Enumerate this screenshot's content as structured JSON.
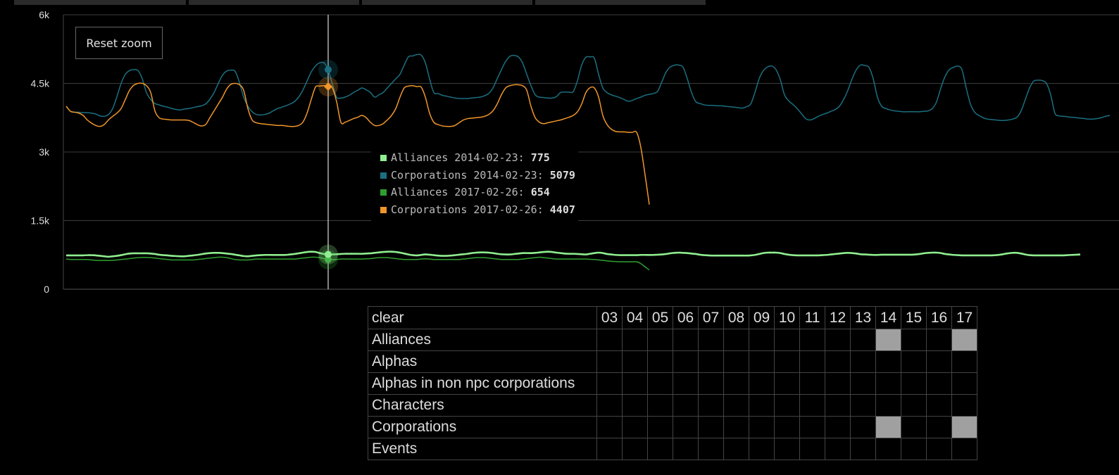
{
  "colors": {
    "alliances_2014": "#90ee90",
    "corporations_2014": "#1b6f80",
    "alliances_2017": "#2fa02f",
    "corporations_2017": "#f0962a",
    "crosshair": "#cccccc",
    "selected_cell": "#a0a0a0"
  },
  "controls": {
    "reset_zoom_label": "Reset zoom"
  },
  "tooltip": {
    "rows": [
      {
        "label": "Alliances 2014-02-23: ",
        "value": "775",
        "color": "#90ee90"
      },
      {
        "label": "Corporations 2014-02-23: ",
        "value": "5079",
        "color": "#1b6f80"
      },
      {
        "label": "Alliances 2017-02-26: ",
        "value": "654",
        "color": "#2fa02f"
      },
      {
        "label": "Corporations 2017-02-26: ",
        "value": "4407",
        "color": "#f0962a"
      }
    ]
  },
  "chart_data": {
    "type": "line",
    "ylim": [
      0,
      6000
    ],
    "y_ticks": [
      {
        "value": 0,
        "label": "0"
      },
      {
        "value": 1500,
        "label": "1.5k"
      },
      {
        "value": 3000,
        "label": "3k"
      },
      {
        "value": 4500,
        "label": "4.5k"
      },
      {
        "value": 6000,
        "label": "6k"
      }
    ],
    "grid": true,
    "hover_index": 62,
    "series": [
      {
        "name": "Corporations 2014-02-23",
        "color": "#1b6f80",
        "values": [
          4000,
          3890,
          3870,
          3870,
          3860,
          3860,
          3850,
          3830,
          3790,
          3780,
          3820,
          3950,
          4210,
          4500,
          4700,
          4780,
          4800,
          4780,
          4600,
          4300,
          4150,
          4060,
          4030,
          4000,
          3980,
          3950,
          3930,
          3920,
          3940,
          3950,
          3970,
          3990,
          4010,
          4050,
          4150,
          4300,
          4500,
          4680,
          4770,
          4790,
          4760,
          4520,
          4200,
          4000,
          3880,
          3820,
          3810,
          3820,
          3850,
          3900,
          3950,
          3980,
          4010,
          4050,
          4100,
          4200,
          4350,
          4550,
          4750,
          4880,
          4950,
          4950,
          4800,
          4480,
          4200,
          4180,
          4200,
          4240,
          4300,
          4350,
          4400,
          4360,
          4300,
          4200,
          4250,
          4300,
          4400,
          4500,
          4600,
          4700,
          4900,
          5080,
          5100,
          5130,
          5120,
          4950,
          4600,
          4300,
          4280,
          4240,
          4220,
          4200,
          4180,
          4170,
          4170,
          4170,
          4180,
          4190,
          4200,
          4230,
          4280,
          4400,
          4600,
          4800,
          4980,
          5090,
          5110,
          5080,
          4950,
          4700,
          4450,
          4250,
          4200,
          4190,
          4180,
          4180,
          4210,
          4300,
          4310,
          4310,
          4320,
          4560,
          4900,
          5070,
          5079,
          5050,
          4700,
          4400,
          4300,
          4250,
          4220,
          4190,
          4150,
          4110,
          4130,
          4170,
          4200,
          4240,
          4260,
          4280,
          4330,
          4540,
          4750,
          4860,
          4900,
          4900,
          4850,
          4600,
          4300,
          4100,
          4060,
          4030,
          4020,
          4020,
          4010,
          4010,
          4000,
          3990,
          3980,
          3970,
          3960,
          3990,
          4050,
          4300,
          4600,
          4780,
          4860,
          4880,
          4800,
          4580,
          4250,
          4120,
          4040,
          3950,
          3840,
          3730,
          3700,
          3730,
          3780,
          3820,
          3850,
          3890,
          3930,
          4000,
          4150,
          4350,
          4600,
          4800,
          4900,
          4890,
          4850,
          4600,
          4200,
          4000,
          3950,
          3920,
          3900,
          3890,
          3880,
          3880,
          3880,
          3880,
          3880,
          3890,
          3900,
          3950,
          4100,
          4400,
          4650,
          4800,
          4850,
          4880,
          4800,
          4400,
          4050,
          3870,
          3800,
          3750,
          3720,
          3710,
          3700,
          3690,
          3690,
          3700,
          3720,
          3760,
          3900,
          4150,
          4400,
          4550,
          4570,
          4560,
          4500,
          4250,
          3850,
          3790,
          3780,
          3770,
          3760,
          3750,
          3740,
          3730,
          3720,
          3720,
          3730,
          3750,
          3780,
          3800
        ]
      },
      {
        "name": "Corporations 2017-02-26",
        "color": "#f0962a",
        "values": [
          4000,
          3890,
          3870,
          3850,
          3800,
          3700,
          3630,
          3580,
          3560,
          3600,
          3700,
          3780,
          3850,
          3950,
          4150,
          4350,
          4460,
          4500,
          4500,
          4450,
          4300,
          3900,
          3750,
          3720,
          3710,
          3700,
          3700,
          3700,
          3700,
          3690,
          3650,
          3600,
          3570,
          3600,
          3750,
          3900,
          4050,
          4200,
          4380,
          4480,
          4500,
          4470,
          4350,
          3950,
          3700,
          3640,
          3620,
          3610,
          3600,
          3590,
          3580,
          3580,
          3570,
          3560,
          3560,
          3580,
          3650,
          3850,
          4150,
          4420,
          4440,
          4450,
          4430,
          4400,
          4100,
          3650,
          3650,
          3690,
          3730,
          3760,
          3800,
          3750,
          3650,
          3580,
          3580,
          3620,
          3700,
          3800,
          3950,
          4200,
          4400,
          4440,
          4450,
          4430,
          4420,
          4200,
          3850,
          3650,
          3600,
          3570,
          3560,
          3560,
          3580,
          3640,
          3700,
          3730,
          3740,
          3750,
          3760,
          3780,
          3820,
          3900,
          4050,
          4250,
          4400,
          4450,
          4470,
          4470,
          4450,
          4350,
          4000,
          3750,
          3650,
          3620,
          3640,
          3660,
          3680,
          3700,
          3730,
          3760,
          3800,
          3880,
          4050,
          4300,
          4407,
          4400,
          4200,
          3800,
          3600,
          3500,
          3450,
          3440,
          3440,
          3430,
          3430,
          3430,
          3100,
          2500,
          1850
        ]
      },
      {
        "name": "Alliances 2014-02-23",
        "color": "#90ee90",
        "values": [
          740,
          740,
          740,
          740,
          740,
          745,
          745,
          740,
          730,
          720,
          710,
          720,
          730,
          745,
          765,
          780,
          785,
          785,
          785,
          785,
          780,
          770,
          755,
          745,
          740,
          730,
          725,
          720,
          720,
          730,
          740,
          750,
          765,
          780,
          790,
          795,
          795,
          790,
          780,
          770,
          755,
          740,
          725,
          720,
          730,
          740,
          745,
          750,
          750,
          750,
          750,
          750,
          750,
          760,
          770,
          785,
          800,
          815,
          820,
          815,
          790,
          770,
          760,
          760,
          765,
          770,
          775,
          775,
          775,
          775,
          775,
          780,
          785,
          795,
          805,
          815,
          820,
          820,
          815,
          800,
          780,
          760,
          745,
          740,
          750,
          760,
          755,
          745,
          735,
          730,
          730,
          735,
          745,
          755,
          765,
          775,
          790,
          800,
          805,
          805,
          800,
          790,
          775,
          765,
          760,
          760,
          770,
          780,
          790,
          790,
          790,
          795,
          805,
          815,
          820,
          815,
          800,
          790,
          780,
          775,
          775,
          770,
          765,
          760,
          775,
          790,
          800,
          790,
          770,
          760,
          750,
          745,
          745,
          745,
          745,
          745,
          750,
          750,
          750,
          750,
          755,
          760,
          770,
          785,
          795,
          800,
          795,
          790,
          780,
          770,
          755,
          745,
          740,
          735,
          735,
          735,
          735,
          735,
          735,
          735,
          735,
          735,
          740,
          750,
          770,
          790,
          800,
          800,
          800,
          790,
          770,
          755,
          745,
          740,
          740,
          740,
          740,
          740,
          740,
          745,
          750,
          760,
          770,
          780,
          790,
          795,
          790,
          780,
          765,
          760,
          755,
          750,
          750,
          755,
          755,
          755,
          755,
          755,
          755,
          755,
          755,
          760,
          770,
          785,
          795,
          800,
          800,
          790,
          770,
          760,
          750,
          745,
          740,
          740,
          740,
          740,
          740,
          740,
          740,
          740,
          745,
          755,
          770,
          785,
          795,
          795,
          780,
          760,
          745,
          740,
          740,
          740,
          740,
          740,
          740,
          740,
          740,
          745,
          750,
          755,
          760
        ]
      },
      {
        "name": "Alliances 2017-02-26",
        "color": "#2fa02f",
        "values": [
          660,
          650,
          650,
          650,
          650,
          650,
          640,
          630,
          630,
          630,
          630,
          630,
          640,
          650,
          660,
          670,
          680,
          690,
          695,
          695,
          690,
          680,
          670,
          660,
          650,
          640,
          640,
          640,
          640,
          640,
          640,
          650,
          660,
          670,
          680,
          690,
          700,
          700,
          690,
          670,
          650,
          640,
          640,
          640,
          650,
          660,
          660,
          660,
          660,
          660,
          660,
          660,
          660,
          660,
          660,
          670,
          680,
          690,
          700,
          700,
          690,
          670,
          650,
          650,
          650,
          660,
          660,
          660,
          660,
          660,
          660,
          665,
          670,
          680,
          690,
          690,
          690,
          680,
          670,
          660,
          650,
          650,
          650,
          650,
          660,
          665,
          660,
          650,
          650,
          650,
          650,
          650,
          650,
          650,
          660,
          670,
          680,
          690,
          690,
          690,
          680,
          670,
          660,
          650,
          650,
          650,
          650,
          650,
          660,
          670,
          680,
          690,
          700,
          690,
          680,
          670,
          660,
          660,
          660,
          660,
          660,
          660,
          660,
          660,
          654,
          650,
          640,
          630,
          620,
          610,
          605,
          600,
          600,
          600,
          600,
          600,
          560,
          490,
          420
        ]
      }
    ]
  },
  "table": {
    "clear_label": "clear",
    "columns": [
      "03",
      "04",
      "05",
      "06",
      "07",
      "08",
      "09",
      "10",
      "11",
      "12",
      "13",
      "14",
      "15",
      "16",
      "17"
    ],
    "rows": [
      {
        "label": "Alliances",
        "selected": [
          "14",
          "17"
        ]
      },
      {
        "label": "Alphas",
        "selected": []
      },
      {
        "label": "Alphas in non npc corporations",
        "selected": []
      },
      {
        "label": "Characters",
        "selected": []
      },
      {
        "label": "Corporations",
        "selected": [
          "14",
          "17"
        ]
      },
      {
        "label": "Events",
        "selected": []
      }
    ]
  }
}
